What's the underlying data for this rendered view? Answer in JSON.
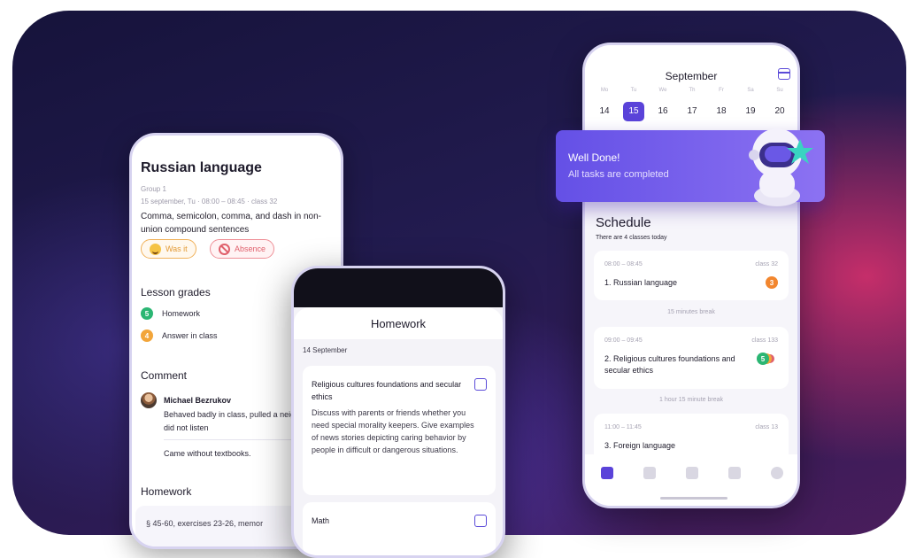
{
  "lesson": {
    "title": "Russian language",
    "group": "Group 1",
    "date_line": "15 september, Tu · 08:00 – 08:45 · class 32",
    "topic": "Comma, semicolon, comma, and dash in non-union compound sentences",
    "chip_was": "Was it",
    "chip_absence": "Absence",
    "grades_title": "Lesson grades",
    "grades": [
      {
        "value": "5",
        "label": "Homework",
        "color": "#2bb673"
      },
      {
        "value": "4",
        "label": "Answer in class",
        "color": "#f2a53a"
      }
    ],
    "comment_title": "Comment",
    "comment_author": "Michael Bezrukov",
    "comment_text": "Behaved badly in class, pulled a neighbor's hair, did not listen",
    "comment_text2": "Came without textbooks.",
    "homework_title": "Homework",
    "homework_preview": "§ 45-60, exercises 23-26, memor"
  },
  "homework_screen": {
    "title": "Homework",
    "date": "14 September",
    "tasks": [
      {
        "subject": "Religious cultures foundations and secular ethics",
        "description": "Discuss with parents or friends whether you need special morality keepers. Give examples of news stories depicting caring behavior by people in difficult or dangerous situations."
      },
      {
        "subject": "Math",
        "description": ""
      }
    ]
  },
  "schedule_screen": {
    "month": "September",
    "week": [
      {
        "dow": "Mo",
        "day": "14",
        "selected": false
      },
      {
        "dow": "Tu",
        "day": "15",
        "selected": true
      },
      {
        "dow": "We",
        "day": "16",
        "selected": false
      },
      {
        "dow": "Th",
        "day": "17",
        "selected": false
      },
      {
        "dow": "Fr",
        "day": "18",
        "selected": false
      },
      {
        "dow": "Sa",
        "day": "19",
        "selected": false
      },
      {
        "dow": "Su",
        "day": "20",
        "selected": false
      }
    ],
    "banner_title": "Well Done!",
    "banner_subtitle": "All tasks are completed",
    "title": "Schedule",
    "subtitle": "There are 4 classes today",
    "lessons": [
      {
        "time": "08:00 – 08:45",
        "room": "class 32",
        "name": "1. Russian language",
        "grade": "3",
        "grade_color": "#f2862e"
      },
      {
        "time": "09:00 – 09:45",
        "room": "class 133",
        "name": "2. Religious cultures foundations and secular ethics",
        "grade": "5",
        "grade_color": "#2bb673"
      },
      {
        "time": "11:00 – 11:45",
        "room": "class 13",
        "name": "3. Foreign language",
        "grade": "",
        "grade_color": ""
      }
    ],
    "breaks": [
      "15 minutes break",
      "1 hour 15 minute break"
    ],
    "accent": "#5a43d9"
  }
}
